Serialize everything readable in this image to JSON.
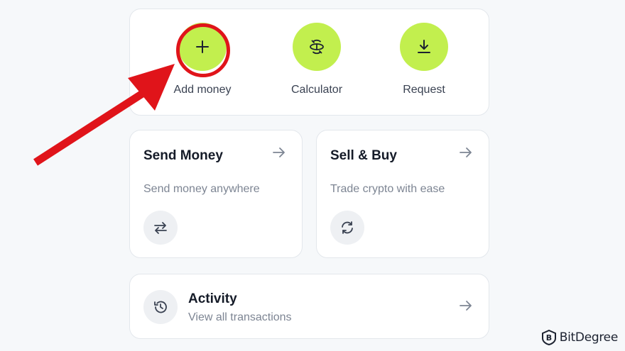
{
  "quick_actions": {
    "add_money": {
      "label": "Add money",
      "icon": "plus-icon"
    },
    "calculator": {
      "label": "Calculator",
      "icon": "calculator-icon"
    },
    "request": {
      "label": "Request",
      "icon": "download-icon"
    }
  },
  "cards": {
    "send_money": {
      "title": "Send Money",
      "description": "Send money anywhere",
      "icon": "swap-arrows-icon"
    },
    "sell_buy": {
      "title": "Sell & Buy",
      "description": "Trade crypto with ease",
      "icon": "refresh-icon"
    }
  },
  "activity": {
    "title": "Activity",
    "description": "View all transactions",
    "icon": "history-icon"
  },
  "watermark": {
    "text": "BitDegree"
  },
  "colors": {
    "accent": "#c2ef4e",
    "annotation": "#e0141a",
    "background": "#f6f8fa",
    "card": "#ffffff"
  }
}
